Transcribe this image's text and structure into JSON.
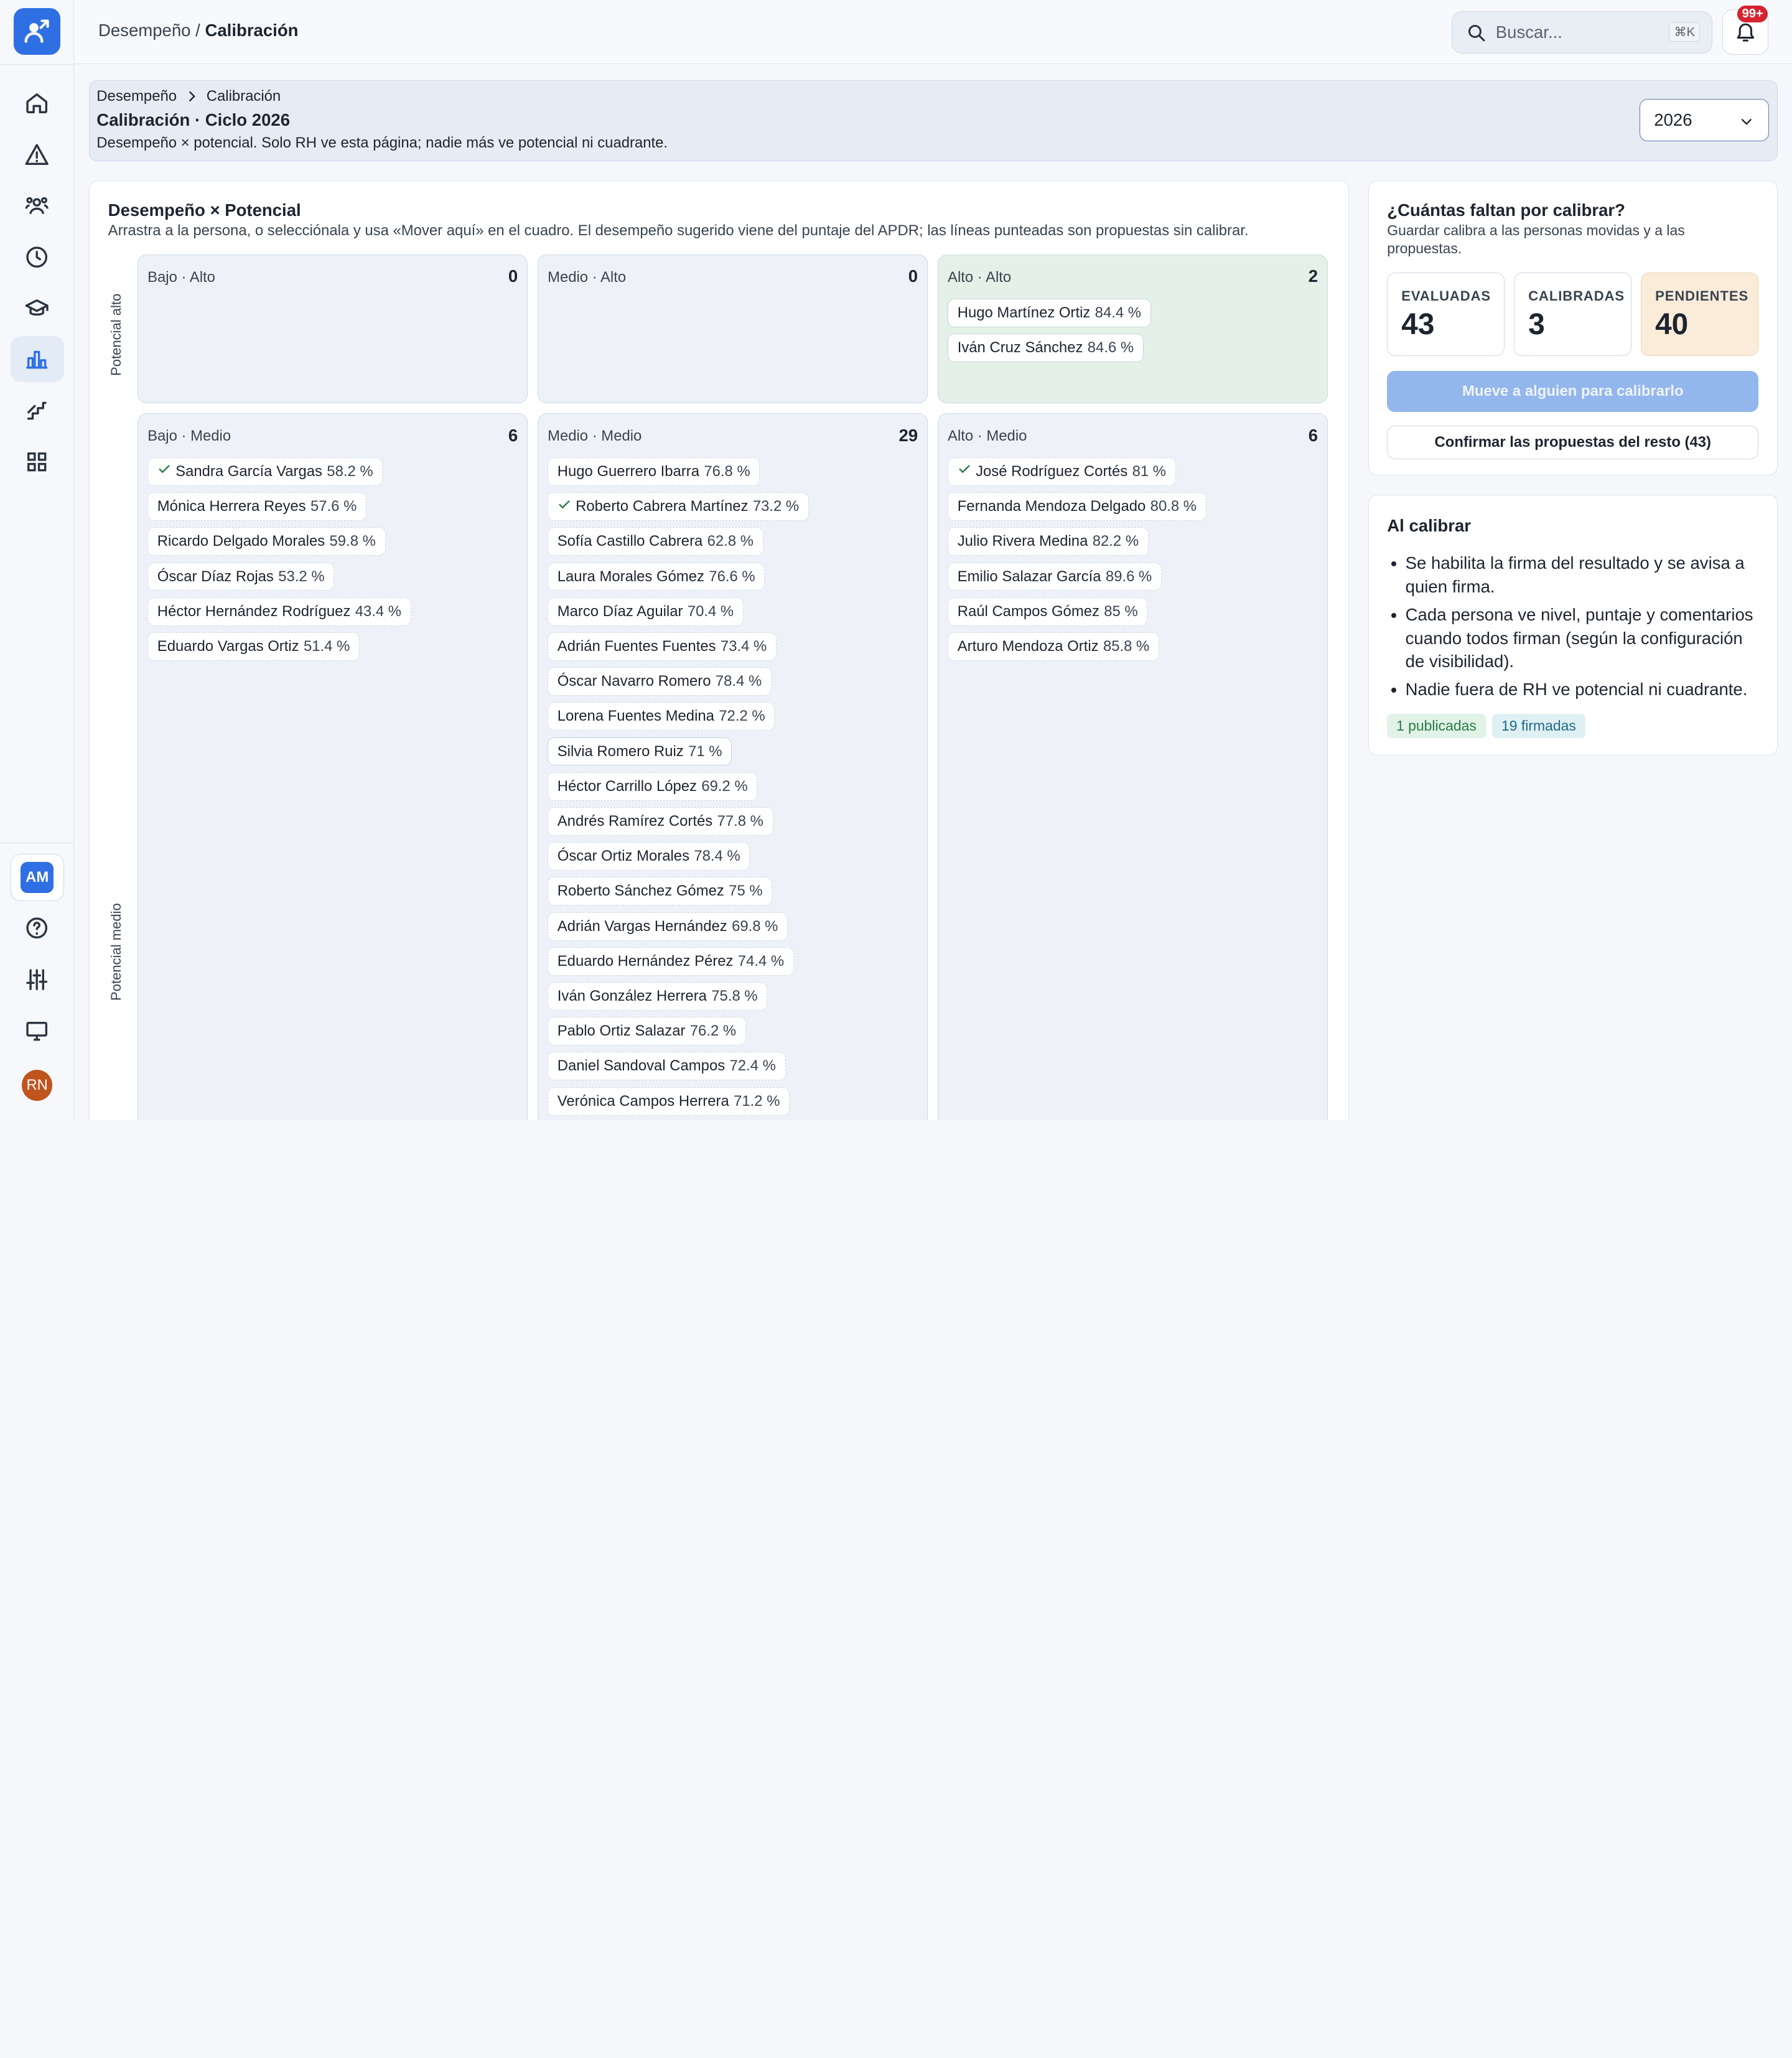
{
  "topbar": {
    "breadcrumb_parent": "Desempeño",
    "breadcrumb_sep": "/",
    "breadcrumb_current": "Calibración",
    "search_placeholder": "Buscar...",
    "search_shortcut": "⌘K",
    "notifications_badge": "99+"
  },
  "sidebar": {
    "items": [
      {
        "icon": "home-icon"
      },
      {
        "icon": "alert-icon"
      },
      {
        "icon": "people-icon"
      },
      {
        "icon": "clock-icon"
      },
      {
        "icon": "graduation-cap-icon"
      },
      {
        "icon": "bar-chart-icon",
        "active": true
      },
      {
        "icon": "stairs-icon"
      },
      {
        "icon": "grid-icon"
      }
    ],
    "workspace_initials": "AM",
    "user_initials": "RN"
  },
  "header": {
    "breadcrumb": [
      "Desempeño",
      "Calibración"
    ],
    "title": "Calibración · Ciclo 2026",
    "subtitle": "Desempeño × potencial. Solo RH ve esta página; nadie más ve potencial ni cuadrante.",
    "year": "2026"
  },
  "grid": {
    "title": "Desempeño × Potencial",
    "subtitle": "Arrastra a la persona, o selecciónala y usa «Mover aquí» en el cuadro. El desempeño sugerido viene del puntaje del APDR; las líneas punteadas son propuestas sin calibrar.",
    "axis_high": "Potencial alto",
    "axis_mid": "Potencial medio",
    "cells": [
      {
        "name": "Bajo · Alto",
        "count": "0",
        "people": []
      },
      {
        "name": "Medio · Alto",
        "count": "0",
        "people": []
      },
      {
        "name": "Alto · Alto",
        "count": "2",
        "people": [
          {
            "name": "Hugo Martínez Ortiz",
            "score": "84.4 %",
            "solid": true
          },
          {
            "name": "Iván Cruz Sánchez",
            "score": "84.6 %",
            "solid": true
          }
        ]
      },
      {
        "name": "Bajo · Medio",
        "count": "6",
        "people": [
          {
            "name": "Sandra García Vargas",
            "score": "58.2 %",
            "checked": true
          },
          {
            "name": "Mónica Herrera Reyes",
            "score": "57.6 %"
          },
          {
            "name": "Ricardo Delgado Morales",
            "score": "59.8 %"
          },
          {
            "name": "Óscar Díaz Rojas",
            "score": "53.2 %"
          },
          {
            "name": "Héctor Hernández Rodríguez",
            "score": "43.4 %"
          },
          {
            "name": "Eduardo Vargas Ortiz",
            "score": "51.4 %"
          }
        ]
      },
      {
        "name": "Medio · Medio",
        "count": "29",
        "people": [
          {
            "name": "Hugo Guerrero Ibarra",
            "score": "76.8 %"
          },
          {
            "name": "Roberto Cabrera Martínez",
            "score": "73.2 %",
            "checked": true
          },
          {
            "name": "Sofía Castillo Cabrera",
            "score": "62.8 %"
          },
          {
            "name": "Laura Morales Gómez",
            "score": "76.6 %"
          },
          {
            "name": "Marco Díaz Aguilar",
            "score": "70.4 %"
          },
          {
            "name": "Adrián Fuentes Fuentes",
            "score": "73.4 %"
          },
          {
            "name": "Óscar Navarro Romero",
            "score": "78.4 %"
          },
          {
            "name": "Lorena Fuentes Medina",
            "score": "72.2 %"
          },
          {
            "name": "Silvia Romero Ruiz",
            "score": "71 %",
            "solid": true
          },
          {
            "name": "Héctor Carrillo López",
            "score": "69.2 %"
          },
          {
            "name": "Andrés Ramírez Cortés",
            "score": "77.8 %"
          },
          {
            "name": "Óscar Ortiz Morales",
            "score": "78.4 %"
          },
          {
            "name": "Roberto Sánchez Gómez",
            "score": "75 %"
          },
          {
            "name": "Adrián Vargas Hernández",
            "score": "69.8 %"
          },
          {
            "name": "Eduardo Hernández Pérez",
            "score": "74.4 %"
          },
          {
            "name": "Iván González Herrera",
            "score": "75.8 %"
          },
          {
            "name": "Pablo Ortiz Salazar",
            "score": "76.2 %"
          },
          {
            "name": "Daniel Sandoval Campos",
            "score": "72.4 %"
          },
          {
            "name": "Verónica Campos Herrera",
            "score": "71.2 %"
          }
        ]
      },
      {
        "name": "Alto · Medio",
        "count": "6",
        "people": [
          {
            "name": "José Rodríguez Cortés",
            "score": "81 %",
            "checked": true
          },
          {
            "name": "Fernanda Mendoza Delgado",
            "score": "80.8 %"
          },
          {
            "name": "Julio Rivera Medina",
            "score": "82.2 %"
          },
          {
            "name": "Emilio Salazar García",
            "score": "89.6 %"
          },
          {
            "name": "Raúl Campos Gómez",
            "score": "85 %"
          },
          {
            "name": "Arturo Mendoza Ortiz",
            "score": "85.8 %"
          }
        ]
      }
    ]
  },
  "progress": {
    "title": "¿Cuántas faltan por calibrar?",
    "subtitle": "Guardar calibra a las personas movidas y a las propuestas.",
    "stats": [
      {
        "label": "EVALUADAS",
        "value": "43"
      },
      {
        "label": "CALIBRADAS",
        "value": "3"
      },
      {
        "label": "PENDIENTES",
        "value": "40"
      }
    ],
    "primary_button": "Mueve a alguien para calibrarlo",
    "secondary_button": "Confirmar las propuestas del resto (43)"
  },
  "info": {
    "title": "Al calibrar",
    "bullets": [
      "Se habilita la firma del resultado y se avisa a quien firma.",
      "Cada persona ve nivel, puntaje y comentarios cuando todos firman (según la configuración de visibilidad).",
      "Nadie fuera de RH ve potencial ni cuadrante."
    ],
    "tag_published": "1 publicadas",
    "tag_signed": "19 firmadas"
  },
  "colors": {
    "accent": "#2f6fe4",
    "cell_green": "#e4f1e8",
    "pending": "#faecd9",
    "danger": "#d6232f"
  }
}
